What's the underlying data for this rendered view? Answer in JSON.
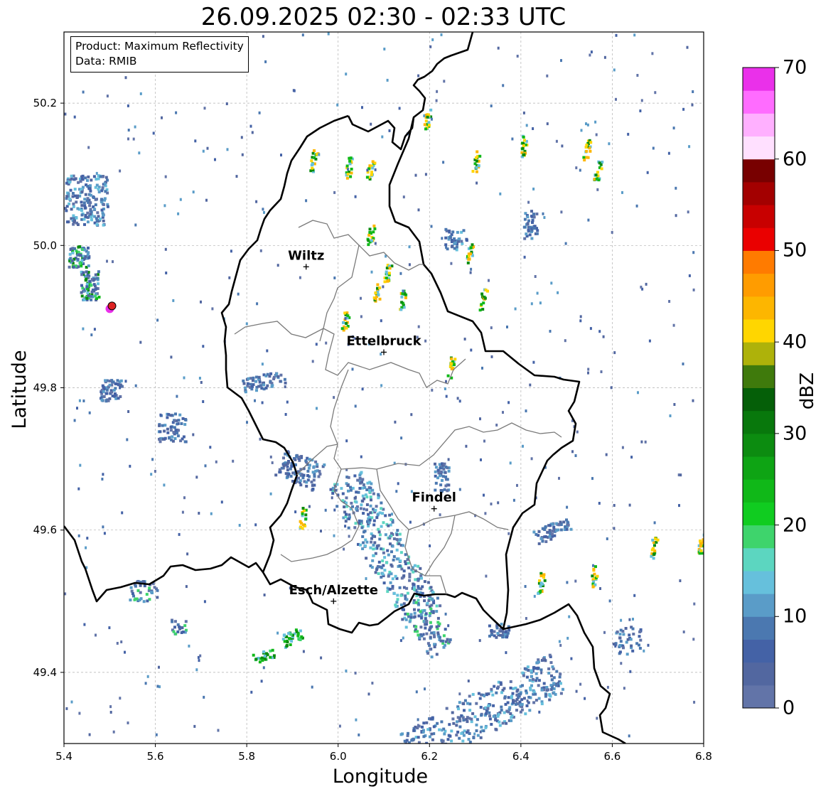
{
  "title": "26.09.2025 02:30 - 02:33 UTC",
  "info_box": {
    "line1": "Product: Maximum Reflectivity",
    "line2": "Data: RMIB"
  },
  "axes": {
    "xlabel": "Longitude",
    "ylabel": "Latitude",
    "xlim": [
      5.4,
      6.8
    ],
    "ylim": [
      49.3,
      50.3
    ],
    "xticks": [
      "5.4",
      "5.6",
      "5.8",
      "6.0",
      "6.2",
      "6.4",
      "6.6",
      "6.8"
    ],
    "yticks": [
      "49.4",
      "49.6",
      "49.8",
      "50.0",
      "50.2"
    ],
    "grid": "dashed light gray"
  },
  "cities": [
    {
      "name": "Wiltz",
      "lon": 5.93,
      "lat": 49.97
    },
    {
      "name": "Ettelbruck",
      "lon": 6.1,
      "lat": 49.85
    },
    {
      "name": "Findel",
      "lon": 6.21,
      "lat": 49.63
    },
    {
      "name": "Esch/Alzette",
      "lon": 5.99,
      "lat": 49.5
    }
  ],
  "radar_site": {
    "lon": 5.505,
    "lat": 49.915,
    "color": "#dd2222"
  },
  "colorbar": {
    "label": "dBZ",
    "ticks": [
      "0",
      "10",
      "20",
      "30",
      "40",
      "50",
      "60",
      "70"
    ],
    "colors": [
      "#6274a8",
      "#5267a0",
      "#4462a6",
      "#4b78b0",
      "#5a9cc8",
      "#66c0dc",
      "#5cd6c0",
      "#3ed46c",
      "#10cc20",
      "#10b818",
      "#0ea414",
      "#0c8c10",
      "#08780c",
      "#055f08",
      "#3f7a0c",
      "#aeb20a",
      "#ffd600",
      "#fdb600",
      "#ff9c00",
      "#ff7b00",
      "#ea0000",
      "#c80000",
      "#a30000",
      "#780000",
      "#ffe0ff",
      "#ffb0ff",
      "#ff6cff",
      "#ea30ea"
    ]
  }
}
